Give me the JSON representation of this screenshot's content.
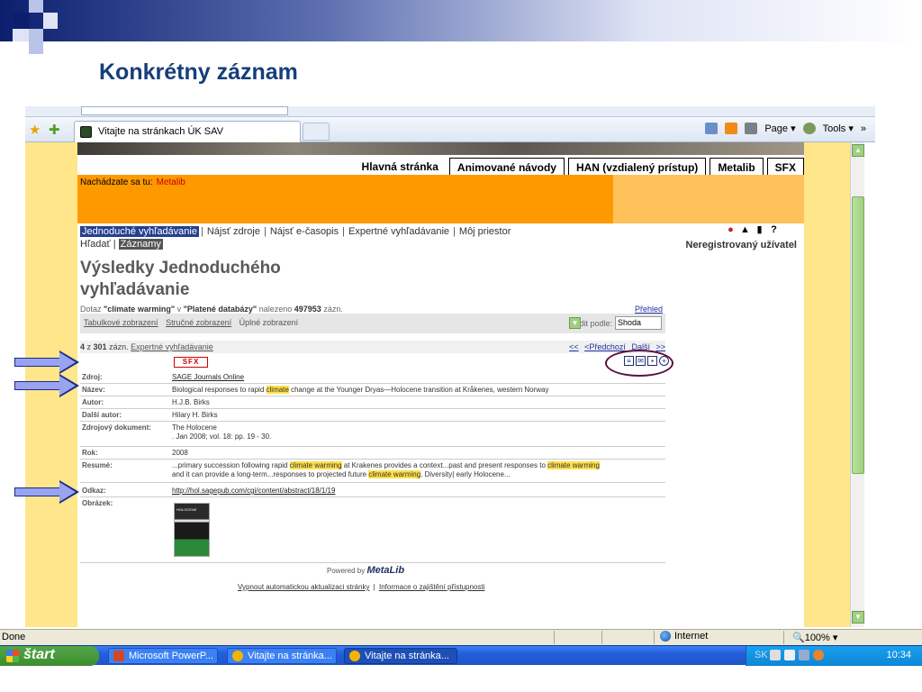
{
  "slide": {
    "title": "Konkrétny záznam"
  },
  "browser": {
    "tab_title": "Vitajte na stránkach ÚK SAV",
    "cmd": {
      "page": "Page ▾",
      "tools": "Tools ▾",
      "more": "»"
    },
    "status": {
      "done": "Done",
      "zone": "Internet",
      "zoom": "🔍100%  ▾"
    }
  },
  "site": {
    "topnav": [
      "Hlavná stránka",
      "Animované návody",
      "HAN (vzdialený prístup)",
      "Metalib",
      "SFX"
    ],
    "location_label": "Nachádzate sa tu:",
    "location_value": "Metalib",
    "menu1": [
      "Jednoduché vyhľadávanie",
      "Nájsť zdroje",
      "Nájsť e-časopis",
      "Expertné vyhľadávanie",
      "Môj priestor"
    ],
    "menu2": [
      "Hľadať",
      "Záznamy"
    ],
    "user": "Neregistrovaný užívatel",
    "heading": "Výsledky Jednoduchého vyhľadávanie",
    "query_prefix": "Dotaz",
    "query_term": "\"climate warming\"",
    "query_mid": "v",
    "query_db": "\"Platené databázy\"",
    "query_suffix": "nalezeno",
    "query_count": "497953",
    "query_unit": "zázn.",
    "overview": "Přehled",
    "view_links": [
      "Tabulkové zobrazení",
      "Stručné zobrazení",
      "Úplné zobrazení"
    ],
    "sort_label": "Řadit podle:",
    "sort_value": "Shoda",
    "nav_left_num": "4",
    "nav_left_mid": "z",
    "nav_left_total": "301",
    "nav_left_unit": "zázn.",
    "nav_left_link": "Expertné vyhľadávanie",
    "nav_right": [
      "<<",
      "<Předchozí",
      "Další",
      ">>"
    ],
    "sfx_label": "SFX",
    "record": {
      "source_k": "Zdroj:",
      "source_v": "SAGE Journals Online",
      "title_k": "Název:",
      "title_v1": "Biological responses to rapid",
      "title_hl": "climate",
      "title_v2": "change at the Younger Dryas—Holocene transition at Kråkenes, western Norway",
      "author_k": "Autor:",
      "author_v": "H.J.B. Birks",
      "coauthor_k": "Další autor:",
      "coauthor_v": "Hilary H. Birks",
      "srcdoc_k": "Zdrojový dokument:",
      "srcdoc_v1": "The Holocene",
      "srcdoc_v2": ". Jan 2008; vol. 18: pp. 19 - 30.",
      "year_k": "Rok:",
      "year_v": "2008",
      "abstract_k": "Resumé:",
      "abs1": "...primary succession following rapid",
      "abs_hl1": "climate warming",
      "abs2": "at Krakenes provides a context...past and present responses to",
      "abs_hl2": "climate warming",
      "abs3": "and it can provide a long-term...responses to projected future",
      "abs_hl3": "climate warming",
      "abs4": ". Diversity| early Holocene...",
      "link_k": "Odkaz:",
      "link_v": "http://hol.sagepub.com/cgi/content/abstract/18/1/19",
      "image_k": "Obrázek:",
      "cover_text": "HOLOCENE"
    },
    "powered_by": "Powered by",
    "metalib": "MetaLib",
    "footer": [
      "Vypnout automatickou aktualizaci stránky",
      "Informace o zajištění přístupnosti"
    ]
  },
  "taskbar": {
    "start": "štart",
    "tasks": [
      "Microsoft PowerP...",
      "Vitajte na stránka...",
      "Vitajte na stránka..."
    ],
    "lang": "SK",
    "clock": "10:34"
  }
}
